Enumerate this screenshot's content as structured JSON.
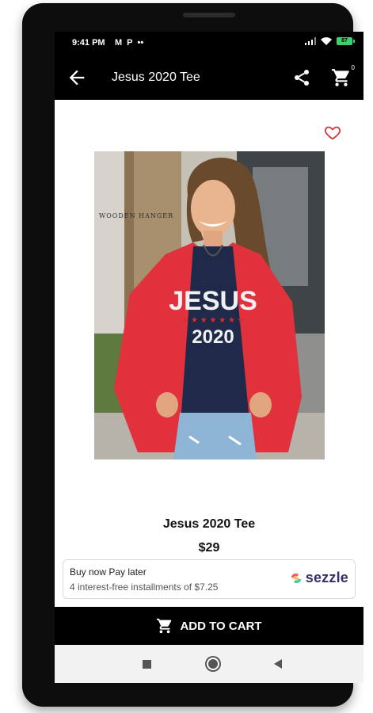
{
  "status_bar": {
    "time": "9:41 PM",
    "notification_icons": [
      "M",
      "P",
      "••"
    ],
    "battery_level": "87"
  },
  "header": {
    "title": "Jesus 2020 Tee",
    "cart_count": "0"
  },
  "product": {
    "name": "Jesus 2020 Tee",
    "price": "$29",
    "image_watermark": "WOODEN HANGER",
    "shirt_text_line1": "JESUS",
    "shirt_text_line2": "2020"
  },
  "sezzle": {
    "line1": "Buy now Pay later",
    "line2": "4 interest-free installments of $7.25",
    "logo": "sezzle"
  },
  "cta": {
    "add_to_cart": "ADD TO CART"
  },
  "colors": {
    "bar": "#000000",
    "heart": "#d63a3a",
    "cardigan": "#e0313d",
    "shirt": "#1f2a4a"
  }
}
